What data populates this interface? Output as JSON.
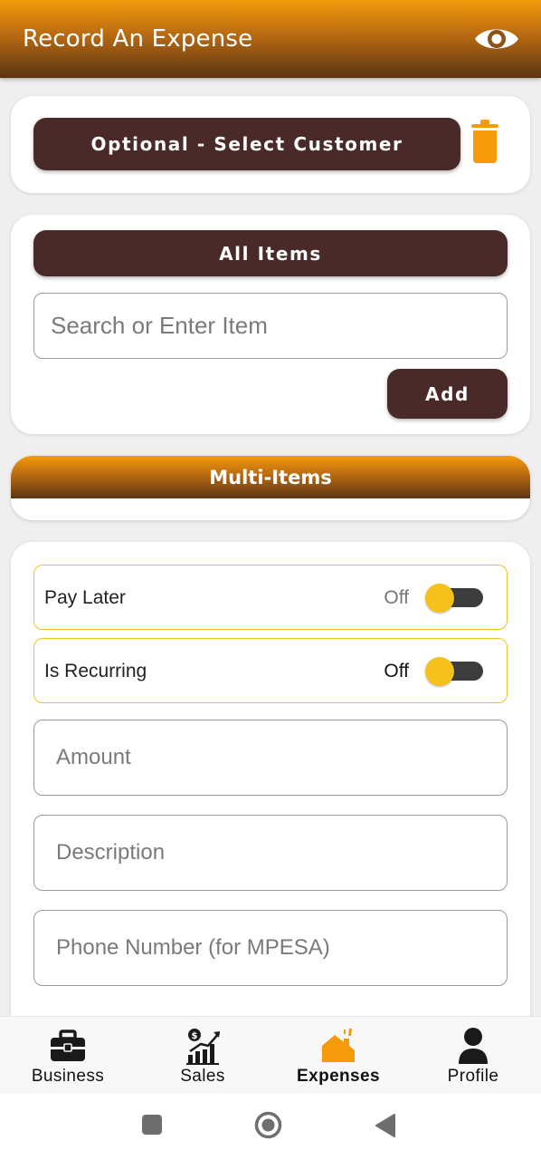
{
  "app": {
    "title": "Record An Expense"
  },
  "customer": {
    "select_label": "Optional - Select Customer"
  },
  "items": {
    "all_items_label": "All Items",
    "search_placeholder": "Search or Enter Item",
    "add_label": "Add"
  },
  "multi_items": {
    "label": "Multi-Items"
  },
  "form": {
    "pay_later": {
      "label": "Pay Later",
      "state": "Off"
    },
    "is_recurring": {
      "label": "Is Recurring",
      "state": "Off"
    },
    "amount_placeholder": "Amount",
    "description_placeholder": "Description",
    "phone_placeholder": "Phone Number (for MPESA)"
  },
  "bottom_nav": [
    {
      "label": "Business",
      "icon": "briefcase-icon"
    },
    {
      "label": "Sales",
      "icon": "sales-chart-icon"
    },
    {
      "label": "Expenses",
      "icon": "expenses-house-icon",
      "active": true
    },
    {
      "label": "Profile",
      "icon": "person-icon"
    }
  ],
  "colors": {
    "brand_orange": "#f29a0c",
    "brand_brown": "#4a2a28",
    "toggle_yellow": "#f5c21c"
  }
}
